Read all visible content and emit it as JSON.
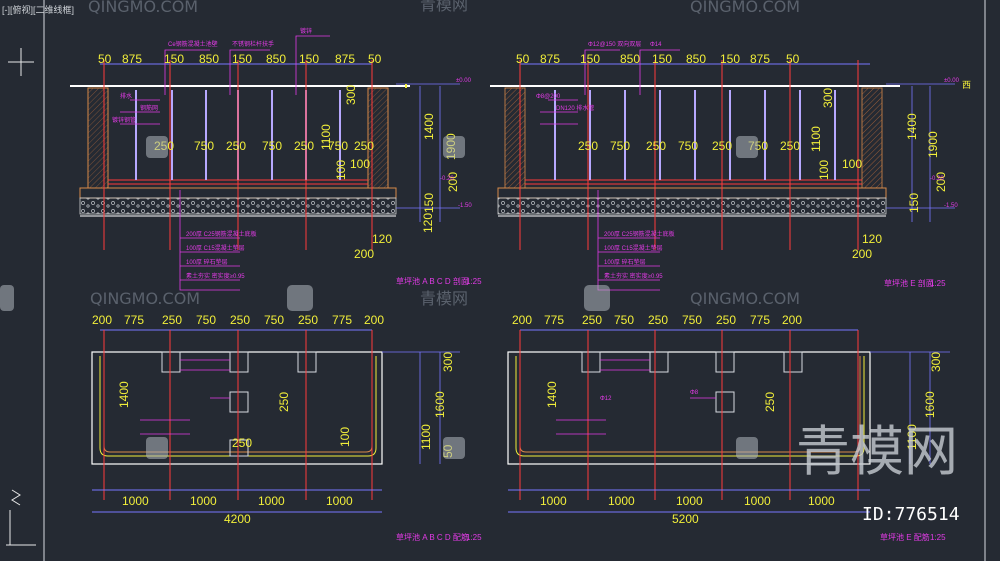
{
  "viewport_label": "[-][俯视][二维线框]",
  "compass_letter": "西",
  "watermarks": {
    "qingmo": "QINGMO.COM",
    "cn": "青模网",
    "big": "青模网"
  },
  "image_id": "ID:776514",
  "left": {
    "top_dims": [
      "50",
      "875",
      "150",
      "850",
      "150",
      "850",
      "150",
      "875",
      "50"
    ],
    "mid_dims": [
      "250",
      "750",
      "250",
      "750",
      "250",
      "750",
      "250"
    ],
    "right_dims_a": [
      "300",
      "1100",
      "1400",
      "100",
      "200",
      "150",
      "120"
    ],
    "elev_a": [
      "±0.00",
      "-0.20",
      "-1.50"
    ],
    "bottom_dim": "200",
    "legend": [
      "200厚 C25钢筋混凝土底板",
      "100厚 C15混凝土垫层",
      "100厚 碎石垫层",
      "素土夯实 密实度≥0.95"
    ],
    "section_title": "草坪池 A B C D 剖面",
    "section_scale": "1:25",
    "plan_top_dims": [
      "200",
      "775",
      "250",
      "750",
      "250",
      "750",
      "250",
      "775",
      "200"
    ],
    "plan_side_dims": [
      "1400",
      "250",
      "250",
      "100",
      "300",
      "1600",
      "1100",
      "50"
    ],
    "plan_bottom_dims": [
      "1000",
      "1000",
      "1000",
      "1000"
    ],
    "plan_total": "4200",
    "plan_title": "草坪池 A B C D 配筋",
    "plan_scale": "1:25"
  },
  "right": {
    "top_dims": [
      "50",
      "875",
      "150",
      "850",
      "150",
      "850",
      "150",
      "875",
      "50"
    ],
    "mid_dims": [
      "250",
      "750",
      "250",
      "750",
      "250",
      "750",
      "250"
    ],
    "right_dims_a": [
      "300",
      "1100",
      "1400",
      "1900",
      "100",
      "200",
      "150",
      "120"
    ],
    "elev_a": [
      "±0.00",
      "-0.20",
      "-1.50"
    ],
    "bottom_dim": "200",
    "legend": [
      "200厚 C25钢筋混凝土底板",
      "100厚 C15混凝土垫层",
      "100厚 碎石垫层",
      "素土夯实 密实度≥0.95"
    ],
    "section_title": "草坪池 E 剖面",
    "section_scale": "1:25",
    "plan_top_dims": [
      "200",
      "775",
      "250",
      "750",
      "250",
      "750",
      "250",
      "775",
      "200"
    ],
    "plan_side_dims": [
      "1400",
      "250",
      "300",
      "1600",
      "1100"
    ],
    "plan_bottom_dims": [
      "1000",
      "1000",
      "1000",
      "1000"
    ],
    "plan_total": "5200",
    "plan_title": "草坪池 E 配筋",
    "plan_scale": "1:25"
  },
  "small_notes": [
    "Ce钢筋混凝土池壁",
    "不锈钢栏杆扶手",
    "镀锌",
    "排水",
    "钢筋网",
    "镀锌钢管",
    "Φ12@150 双向双层",
    "Φ14",
    "Φ8@200",
    "DN120 排水管",
    "Φ12",
    "Φ8"
  ]
}
